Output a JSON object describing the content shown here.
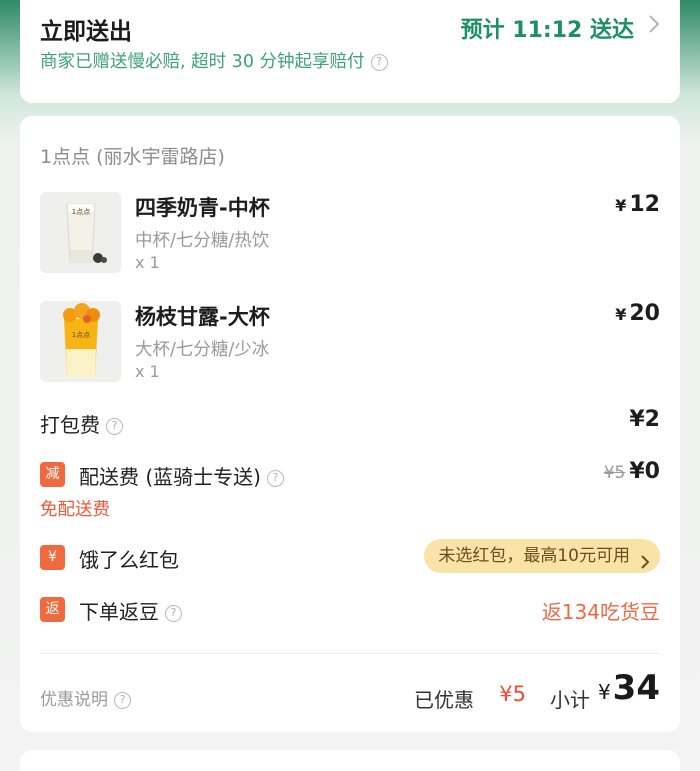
{
  "delivery": {
    "title": "立即送出",
    "eta": "预计 11:12 送达",
    "subtitle": "商家已赠送慢必赔, 超时 30 分钟起享赔付"
  },
  "order": {
    "store": "1点点 (丽水宇雷路店)",
    "currency": "¥",
    "items": [
      {
        "name": "四季奶青-中杯",
        "spec": "中杯/七分糖/热饮",
        "qty": "x 1",
        "price": "12",
        "image": "milk-tea-cup"
      },
      {
        "name": "杨枝甘露-大杯",
        "spec": "大杯/七分糖/少冰",
        "qty": "x 1",
        "price": "20",
        "image": "mango-pomelo-cup"
      }
    ],
    "packaging": {
      "label": "打包费",
      "value": "¥2"
    },
    "delivery_fee": {
      "tag": "减",
      "label": "配送费 (蓝骑士专送)",
      "original": "¥5",
      "value": "¥0",
      "note": "免配送费"
    },
    "red_packet": {
      "tag": "¥",
      "label": "饿了么红包",
      "pill": "未选红包，最高10元可用"
    },
    "cashback": {
      "tag": "返",
      "label": "下单返豆",
      "value": "返134吃货豆"
    },
    "footer": {
      "discount_info": "优惠说明",
      "saved_label": "已优惠",
      "saved_amount": "¥5",
      "subtotal_label": "小计",
      "subtotal_currency": "¥",
      "subtotal_amount": "34"
    }
  },
  "colors": {
    "brand_green": "#1d8f68",
    "accent_orange": "#ef6a3f",
    "pill_bg": "#fbe2a6",
    "discount_red": "#ee4b2f"
  }
}
